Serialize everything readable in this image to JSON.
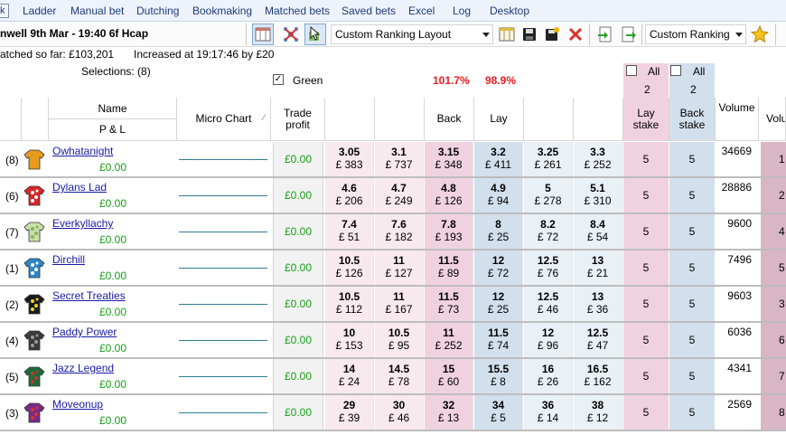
{
  "menu": [
    {
      "label": "Ladder"
    },
    {
      "label": "Manual bet"
    },
    {
      "label": "Dutching"
    },
    {
      "label": "Bookmaking"
    },
    {
      "label": "Matched bets"
    },
    {
      "label": "Saved bets"
    },
    {
      "label": "Excel"
    },
    {
      "label": "Log"
    },
    {
      "label": "Desktop"
    }
  ],
  "menu_first_fragment": "k",
  "toolbar": {
    "market_title": "nwell 9th Mar - 19:40 6f Hcap",
    "layout_dropdown": "Custom Ranking Layout",
    "ranking_dropdown": "Custom Ranking",
    "icons": [
      "columns-icon",
      "network-icon",
      "cursor-icon",
      "columns-settings-icon",
      "save-icon",
      "save-as-icon",
      "delete-icon",
      "import-icon",
      "export-icon",
      "star-icon"
    ]
  },
  "info": {
    "matched": "atched so far: £103,201",
    "increased": "Increased at 19:17:46 by £20",
    "selections": "Selections: (8)",
    "green_label": "Green",
    "back_book": "101.7%",
    "lay_book": "98.9%",
    "lay_all_label": "All",
    "lay_all_value": "2",
    "back_all_label": "All",
    "back_all_value": "2"
  },
  "columns": {
    "name": "Name",
    "pl": "P & L",
    "micro": "Micro Chart",
    "trade_profit": "Trade profit",
    "back": "Back",
    "lay": "Lay",
    "lay_stake": "Lay stake",
    "back_stake": "Back stake",
    "volume": "Volume",
    "volume_rank": "Volu Ran"
  },
  "colors": {
    "back_best": "#f0d2df",
    "back": "#f8e9ef",
    "lay_best": "#d2dfec",
    "lay": "#e9f0f6",
    "profit_green": "#14a014",
    "book_red": "#e31c23"
  },
  "runners": [
    {
      "idx": "(8)",
      "name": "Owhatanight",
      "pl": "£0.00",
      "tp": "£0.00",
      "silk": [
        "#e69a20",
        "#e69a20"
      ],
      "back": [
        {
          "o": "3.05",
          "a": "£ 383"
        },
        {
          "o": "3.1",
          "a": "£ 737"
        },
        {
          "o": "3.15",
          "a": "£ 348"
        }
      ],
      "lay": [
        {
          "o": "3.2",
          "a": "£ 411"
        },
        {
          "o": "3.25",
          "a": "£ 261"
        },
        {
          "o": "3.3",
          "a": "£ 252"
        }
      ],
      "lay_stake": "5",
      "back_stake": "5",
      "volume": "34669",
      "rank": "1"
    },
    {
      "idx": "(6)",
      "name": "Dylans Lad",
      "pl": "£0.00",
      "tp": "£0.00",
      "silk": [
        "#d62828",
        "#ffffff"
      ],
      "back": [
        {
          "o": "4.6",
          "a": "£ 206"
        },
        {
          "o": "4.7",
          "a": "£ 249"
        },
        {
          "o": "4.8",
          "a": "£ 126"
        }
      ],
      "lay": [
        {
          "o": "4.9",
          "a": "£ 94"
        },
        {
          "o": "5",
          "a": "£ 278"
        },
        {
          "o": "5.1",
          "a": "£ 310"
        }
      ],
      "lay_stake": "5",
      "back_stake": "5",
      "volume": "28886",
      "rank": "2"
    },
    {
      "idx": "(7)",
      "name": "Everkyllachy",
      "pl": "£0.00",
      "tp": "£0.00",
      "silk": [
        "#c8e0a8",
        "#8bb060"
      ],
      "back": [
        {
          "o": "7.4",
          "a": "£ 51"
        },
        {
          "o": "7.6",
          "a": "£ 182"
        },
        {
          "o": "7.8",
          "a": "£ 193"
        }
      ],
      "lay": [
        {
          "o": "8",
          "a": "£ 25"
        },
        {
          "o": "8.2",
          "a": "£ 72"
        },
        {
          "o": "8.4",
          "a": "£ 54"
        }
      ],
      "lay_stake": "5",
      "back_stake": "5",
      "volume": "9600",
      "rank": "4"
    },
    {
      "idx": "(1)",
      "name": "Dirchill",
      "pl": "£0.00",
      "tp": "£0.00",
      "silk": [
        "#2e86c8",
        "#ffffff"
      ],
      "back": [
        {
          "o": "10.5",
          "a": "£ 126"
        },
        {
          "o": "11",
          "a": "£ 127"
        },
        {
          "o": "11.5",
          "a": "£ 89"
        }
      ],
      "lay": [
        {
          "o": "12",
          "a": "£ 72"
        },
        {
          "o": "12.5",
          "a": "£ 76"
        },
        {
          "o": "13",
          "a": "£ 21"
        }
      ],
      "lay_stake": "5",
      "back_stake": "5",
      "volume": "7496",
      "rank": "5"
    },
    {
      "idx": "(2)",
      "name": "Secret Treaties",
      "pl": "£0.00",
      "tp": "£0.00",
      "silk": [
        "#1a1a1a",
        "#f2d21b"
      ],
      "back": [
        {
          "o": "10.5",
          "a": "£ 112"
        },
        {
          "o": "11",
          "a": "£ 167"
        },
        {
          "o": "11.5",
          "a": "£ 73"
        }
      ],
      "lay": [
        {
          "o": "12",
          "a": "£ 25"
        },
        {
          "o": "12.5",
          "a": "£ 46"
        },
        {
          "o": "13",
          "a": "£ 36"
        }
      ],
      "lay_stake": "5",
      "back_stake": "5",
      "volume": "9603",
      "rank": "3"
    },
    {
      "idx": "(4)",
      "name": "Paddy Power",
      "pl": "£0.00",
      "tp": "£0.00",
      "silk": [
        "#3a3a3a",
        "#9a9a9a"
      ],
      "back": [
        {
          "o": "10",
          "a": "£ 153"
        },
        {
          "o": "10.5",
          "a": "£ 95"
        },
        {
          "o": "11",
          "a": "£ 252"
        }
      ],
      "lay": [
        {
          "o": "11.5",
          "a": "£ 74"
        },
        {
          "o": "12",
          "a": "£ 96"
        },
        {
          "o": "12.5",
          "a": "£ 47"
        }
      ],
      "lay_stake": "5",
      "back_stake": "5",
      "volume": "6036",
      "rank": "6"
    },
    {
      "idx": "(5)",
      "name": "Jazz Legend",
      "pl": "£0.00",
      "tp": "£0.00",
      "silk": [
        "#1f6b3a",
        "#c0392b"
      ],
      "back": [
        {
          "o": "14",
          "a": "£ 24"
        },
        {
          "o": "14.5",
          "a": "£ 78"
        },
        {
          "o": "15",
          "a": "£ 60"
        }
      ],
      "lay": [
        {
          "o": "15.5",
          "a": "£ 8"
        },
        {
          "o": "16",
          "a": "£ 26"
        },
        {
          "o": "16.5",
          "a": "£ 162"
        }
      ],
      "lay_stake": "5",
      "back_stake": "5",
      "volume": "4341",
      "rank": "7"
    },
    {
      "idx": "(3)",
      "name": "Moveonup",
      "pl": "£0.00",
      "tp": "£0.00",
      "silk": [
        "#7a2a8a",
        "#d63a2a"
      ],
      "back": [
        {
          "o": "29",
          "a": "£ 39"
        },
        {
          "o": "30",
          "a": "£ 46"
        },
        {
          "o": "32",
          "a": "£ 13"
        }
      ],
      "lay": [
        {
          "o": "34",
          "a": "£ 5"
        },
        {
          "o": "36",
          "a": "£ 14"
        },
        {
          "o": "38",
          "a": "£ 12"
        }
      ],
      "lay_stake": "5",
      "back_stake": "5",
      "volume": "2569",
      "rank": "8"
    }
  ]
}
